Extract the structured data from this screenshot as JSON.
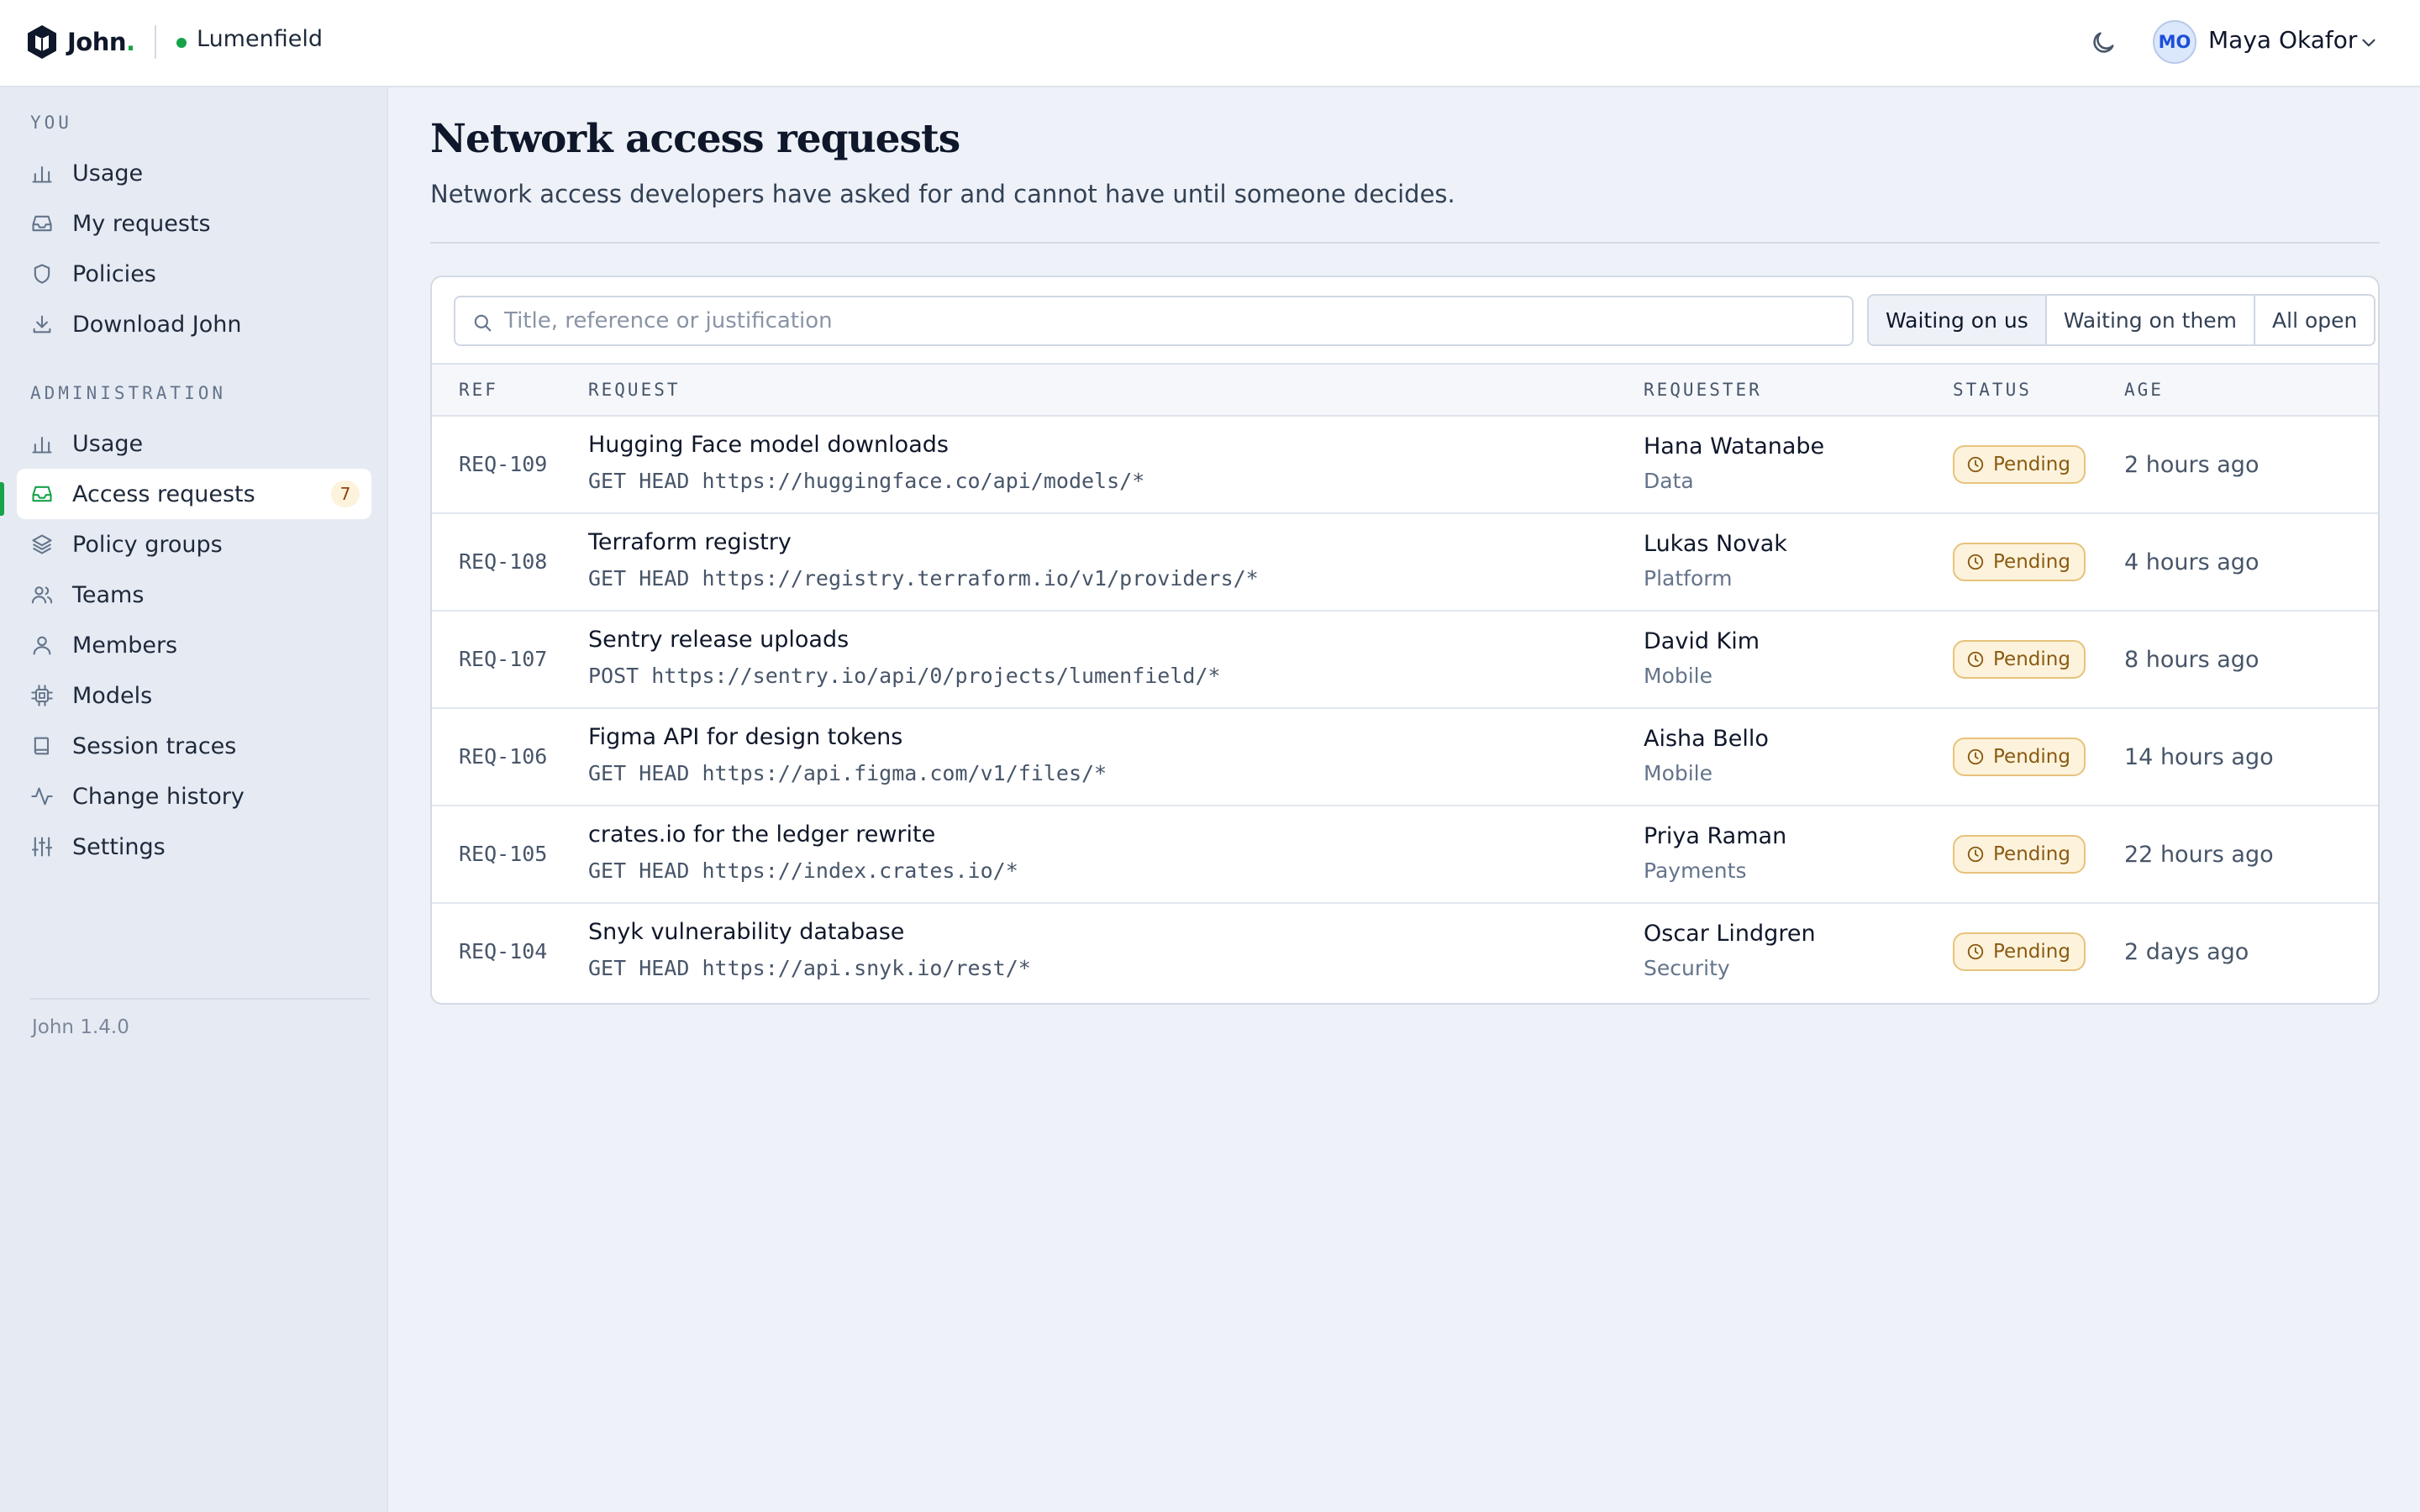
{
  "brand": {
    "name": "John",
    "dot": "."
  },
  "workspace": {
    "name": "Lumenfield",
    "status_color": "#16a34a"
  },
  "user": {
    "initials": "MO",
    "name": "Maya Okafor"
  },
  "sidebar": {
    "you_title": "YOU",
    "you_items": [
      {
        "label": "Usage",
        "icon": "bar-chart-icon"
      },
      {
        "label": "My requests",
        "icon": "inbox-icon"
      },
      {
        "label": "Policies",
        "icon": "shield-icon"
      },
      {
        "label": "Download John",
        "icon": "download-icon"
      }
    ],
    "admin_title": "ADMINISTRATION",
    "admin_items": [
      {
        "label": "Usage",
        "icon": "bar-chart-icon"
      },
      {
        "label": "Access requests",
        "icon": "inbox-icon",
        "badge": "7",
        "active": true
      },
      {
        "label": "Policy groups",
        "icon": "layers-icon"
      },
      {
        "label": "Teams",
        "icon": "users-icon"
      },
      {
        "label": "Members",
        "icon": "user-icon"
      },
      {
        "label": "Models",
        "icon": "cpu-icon"
      },
      {
        "label": "Session traces",
        "icon": "book-icon"
      },
      {
        "label": "Change history",
        "icon": "activity-icon"
      },
      {
        "label": "Settings",
        "icon": "sliders-icon"
      }
    ],
    "version": "John 1.4.0"
  },
  "page": {
    "title": "Network access requests",
    "subtitle": "Network access developers have asked for and cannot have until someone decides."
  },
  "search": {
    "placeholder": "Title, reference or justification",
    "value": ""
  },
  "filters": [
    "Waiting on us",
    "Waiting on them",
    "All open"
  ],
  "filter_selected": "Waiting on us",
  "table": {
    "columns": {
      "ref": "REF",
      "request": "REQUEST",
      "requester": "REQUESTER",
      "status": "STATUS",
      "age": "AGE"
    },
    "rows": [
      {
        "ref": "REQ-109",
        "title": "Hugging Face model downloads",
        "url": "GET HEAD https://huggingface.co/api/models/*",
        "requester": "Hana Watanabe",
        "team": "Data",
        "status": "Pending",
        "age": "2 hours ago"
      },
      {
        "ref": "REQ-108",
        "title": "Terraform registry",
        "url": "GET HEAD https://registry.terraform.io/v1/providers/*",
        "requester": "Lukas Novak",
        "team": "Platform",
        "status": "Pending",
        "age": "4 hours ago"
      },
      {
        "ref": "REQ-107",
        "title": "Sentry release uploads",
        "url": "POST https://sentry.io/api/0/projects/lumenfield/*",
        "requester": "David Kim",
        "team": "Mobile",
        "status": "Pending",
        "age": "8 hours ago"
      },
      {
        "ref": "REQ-106",
        "title": "Figma API for design tokens",
        "url": "GET HEAD https://api.figma.com/v1/files/*",
        "requester": "Aisha Bello",
        "team": "Mobile",
        "status": "Pending",
        "age": "14 hours ago"
      },
      {
        "ref": "REQ-105",
        "title": "crates.io for the ledger rewrite",
        "url": "GET HEAD https://index.crates.io/*",
        "requester": "Priya Raman",
        "team": "Payments",
        "status": "Pending",
        "age": "22 hours ago"
      },
      {
        "ref": "REQ-104",
        "title": "Snyk vulnerability database",
        "url": "GET HEAD https://api.snyk.io/rest/*",
        "requester": "Oscar Lindgren",
        "team": "Security",
        "status": "Pending",
        "age": "2 days ago"
      }
    ]
  },
  "colors": {
    "accent": "#16a34a",
    "pending_bg": "#fdf3dc",
    "pending_border": "#e7c27c",
    "pending_text": "#8a5a12"
  }
}
